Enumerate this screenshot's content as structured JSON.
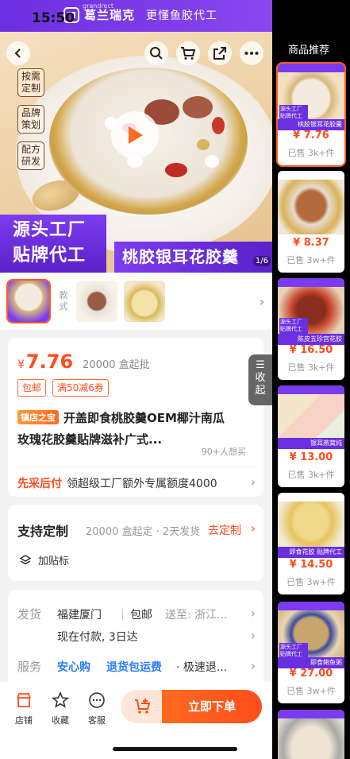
{
  "status": {
    "time": "15:50"
  },
  "hero": {
    "brand_en": "grandrect",
    "brand_name": "葛兰瑞克",
    "brand_slogan": "更懂鱼胶代工",
    "tags": [
      "按需定制",
      "品牌策划",
      "配方研发"
    ],
    "banner_left_1": "源头工厂",
    "banner_left_2": "贴牌代工",
    "banner_right": "桃胶银耳花胶羹",
    "page_indicator": "1/6"
  },
  "thumbs": {
    "label": "款式"
  },
  "price": {
    "symbol": "¥",
    "value": "7.76",
    "moq": "20000 盒起批",
    "coupons": [
      "包邮",
      "满50减6券"
    ],
    "badge": "镇店之宝",
    "title_1": "开盖即食桃胶羹OEM椰汁南瓜",
    "title_2": "玫瑰花胶羹贴牌滋补广式...",
    "want": "90+人想买",
    "pay_highlight": "先采后付",
    "pay_text": "领超级工厂额外专属额度4000"
  },
  "customize": {
    "title": "支持定制",
    "info": "20000 盒起定 · 2天发货",
    "link": "去定制",
    "add_label": "加贴标"
  },
  "shipping": {
    "ship_label": "发货",
    "origin": "福建厦门",
    "free": "包邮",
    "dest": "送至: 浙江...",
    "delivery": "现在付款, 3日达",
    "service_label": "服务",
    "service_1": "安心购",
    "service_2": "退货包运费",
    "service_3": "· 极速退..."
  },
  "bottom": {
    "store": "店铺",
    "fav": "收藏",
    "service": "客服",
    "buy": "立即下单"
  },
  "collapse": {
    "icon_char": "☰",
    "line1": "收",
    "line2": "起"
  },
  "side": {
    "title": "商品推荐",
    "items": [
      {
        "price": "¥ 7.76",
        "sold": "已售 3k+件",
        "caption": "桃胶银耳花胶羹"
      },
      {
        "price": "¥ 8.37",
        "sold": "已售 3w+件",
        "caption": ""
      },
      {
        "price": "¥ 16.50",
        "sold": "已售 3k+件",
        "caption": "陈皮五珍宫花胶"
      },
      {
        "price": "¥ 13.00",
        "sold": "已售 3k+件",
        "caption": "银耳燕窝炖"
      },
      {
        "price": "¥ 14.50",
        "sold": "已售 3w+件",
        "caption": "即食花胶 贴牌代工"
      },
      {
        "price": "¥ 27.00",
        "sold": "已售 3w+件",
        "caption": "即食鲍鱼粥"
      }
    ]
  },
  "colors": {
    "accent": "#ff4d1c",
    "brand_purple": "#6c2fe0",
    "blue": "#2a7cf7"
  }
}
